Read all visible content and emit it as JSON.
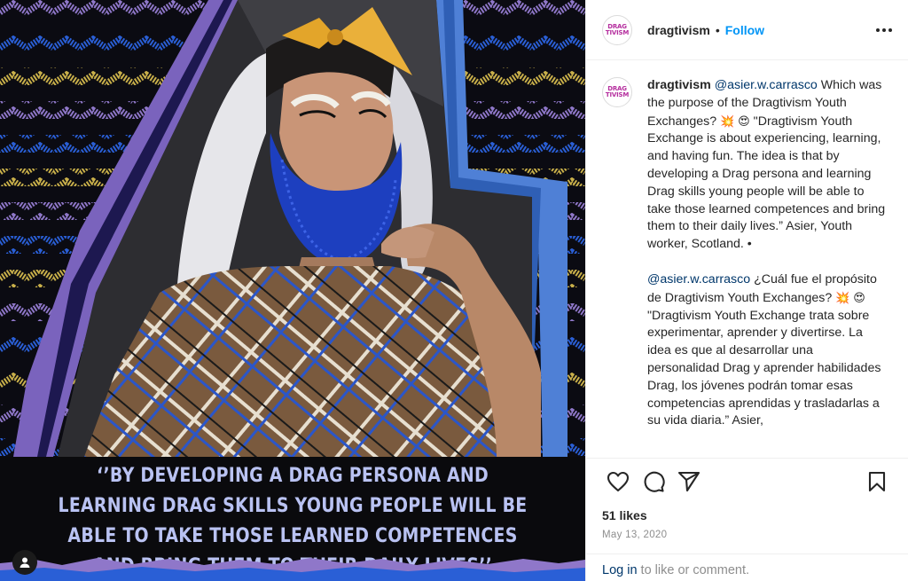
{
  "post": {
    "account": {
      "username": "dragtivism",
      "avatar_logo_line1": "DRAG",
      "avatar_logo_line2": "TIVISM",
      "follow_label": "Follow",
      "separator": "•"
    },
    "image": {
      "quote_text": "‘’BY DEVELOPING A DRAG PERSONA AND LEARNING DRAG SKILLS YOUNG PEOPLE WILL BE ABLE TO TAKE THOSE LEARNED COMPETENCES AND BRING THEM TO THEIR DAILY LIVES’’",
      "colors": {
        "quote": "#b9c2f2",
        "beard": "#1d3fbf",
        "left_stripe": "#7a63bd",
        "right_stripe": "#4f80d6",
        "zigzag_blue": "#2a5fd6",
        "zigzag_gold": "#c9b04a",
        "zigzag_purple": "#8f77c9"
      }
    },
    "caption": {
      "username": "dragtivism",
      "en_mention": "@asier.w.carrasco",
      "en_text_1": " Which was the purpose of the Dragtivism Youth Exchanges? ",
      "en_emoji_1": "💥",
      "en_emoji_2": "😍",
      "en_text_2": " \"Dragtivism Youth Exchange is about experiencing, learning, and having fun. The idea is that by developing a Drag persona and learning Drag skills young people will be able to take those learned competences and bring them to their daily lives.” Asier, Youth worker, Scotland. •",
      "es_mention": "@asier.w.carrasco",
      "es_text_1": " ¿Cuál fue el propósito de Dragtivism Youth Exchanges? ",
      "es_emoji_1": "💥",
      "es_emoji_2": "😍",
      "es_text_2": " \"Dragtivism Youth Exchange trata sobre experimentar, aprender y divertirse. La idea es que al desarrollar una personalidad Drag y aprender habilidades Drag, los jóvenes podrán tomar esas competencias aprendidas y trasladarlas a su vida diaria.” Asier,"
    },
    "actions": {
      "like_icon": "heart-icon",
      "comment_icon": "comment-icon",
      "share_icon": "send-icon",
      "save_icon": "bookmark-icon"
    },
    "likes_text": "51 likes",
    "date_text": "May 13, 2020",
    "login": {
      "link": "Log in",
      "rest": " to like or comment."
    }
  }
}
